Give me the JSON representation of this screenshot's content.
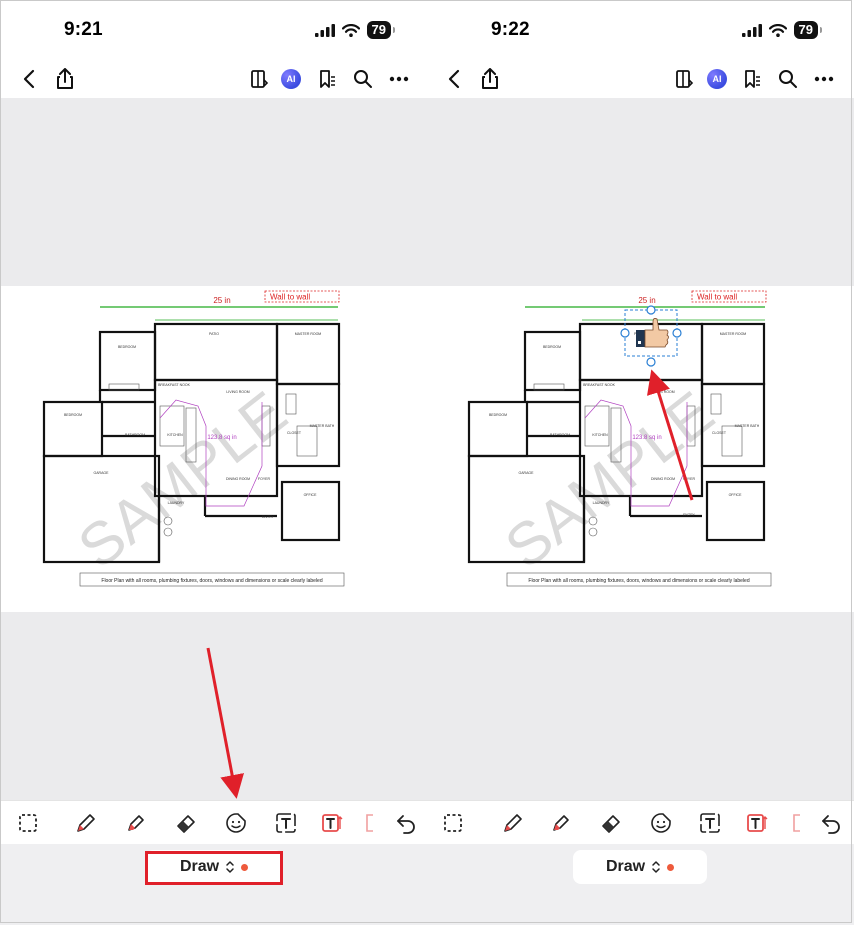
{
  "left": {
    "time": "9:21",
    "battery": "79",
    "mode_label": "Draw"
  },
  "right": {
    "time": "9:22",
    "battery": "79",
    "mode_label": "Draw"
  },
  "ai_badge": "AI",
  "floorplan": {
    "dimension_label": "25 in",
    "callout": "Wall to wall",
    "area_label": "123.8 sq in",
    "watermark": "SAMPLE",
    "caption": "Floor Plan with all rooms, plumbing fixtures, doors, windows and dimensions or scale clearly labeled",
    "rooms": [
      "BEDROOM",
      "PATIO",
      "MASTER ROOM",
      "BREAKFAST NOOK",
      "LIVING ROOM",
      "BEDROOM",
      "BATHROOM",
      "KITCHEN",
      "CLOSET",
      "MASTER BATH",
      "GARAGE",
      "DINING ROOM",
      "FOYER",
      "LAUNDRY",
      "ENTRY",
      "OFFICE"
    ]
  },
  "toolbar_icons": [
    "select-icon",
    "pen-icon",
    "highlighter-icon",
    "eraser-icon",
    "sticker-icon",
    "text-box-icon",
    "text-callout-icon",
    "undo-icon"
  ],
  "colors": {
    "accent_red": "#e0202a",
    "dimension_green": "#22aa22",
    "callout_red": "#dd2222",
    "area_purple": "#b040c0",
    "selection_blue": "#2a7fd4",
    "mode_dot": "#ee5a3c"
  }
}
